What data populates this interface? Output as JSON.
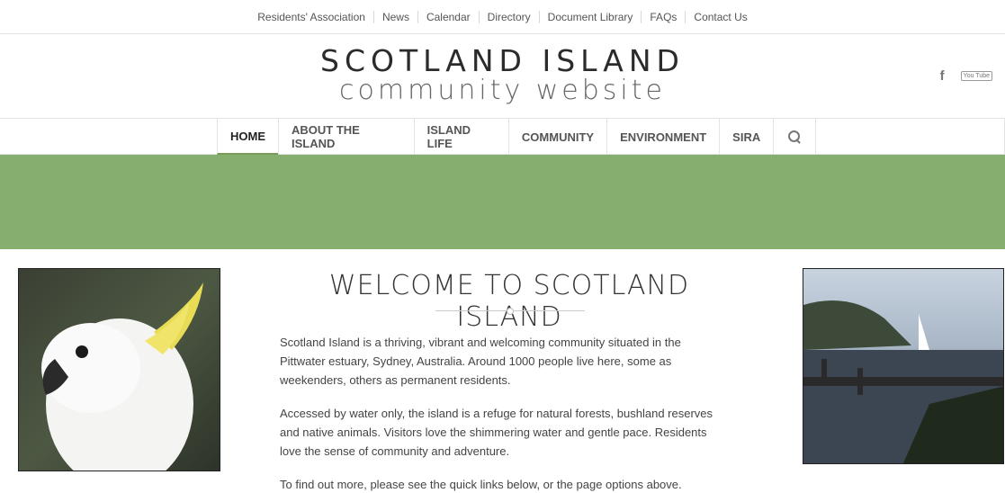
{
  "topbar": {
    "items": [
      "Residents' Association",
      "News",
      "Calendar",
      "Directory",
      "Document Library",
      "FAQs",
      "Contact Us"
    ]
  },
  "header": {
    "logo_line1": "SCOTLAND ISLAND",
    "logo_line2": "community website",
    "social": {
      "facebook": "f",
      "youtube": "You Tube"
    }
  },
  "nav": {
    "items": [
      "HOME",
      "ABOUT THE ISLAND",
      "ISLAND LIFE",
      "COMMUNITY",
      "ENVIRONMENT",
      "SIRA"
    ],
    "active": "HOME"
  },
  "colors": {
    "banner": "#86ae6e",
    "accent": "#7a9a5a"
  },
  "main": {
    "title": "WELCOME TO SCOTLAND ISLAND",
    "paragraphs": [
      "Scotland Island is a thriving, vibrant and welcoming community situated in the Pittwater estuary, Sydney, Australia. Around 1000 people live here, some as weekenders, others as permanent residents.",
      "Accessed by water only, the island is a refuge for natural forests, bushland reserves and native animals. Visitors love the shimmering water and gentle pace. Residents love the sense of community and adventure.",
      "To find out more, please see the quick links below, or the page options above."
    ]
  },
  "images": {
    "left": "cockatoo-photo",
    "right": "pittwater-sailboat-photo"
  }
}
